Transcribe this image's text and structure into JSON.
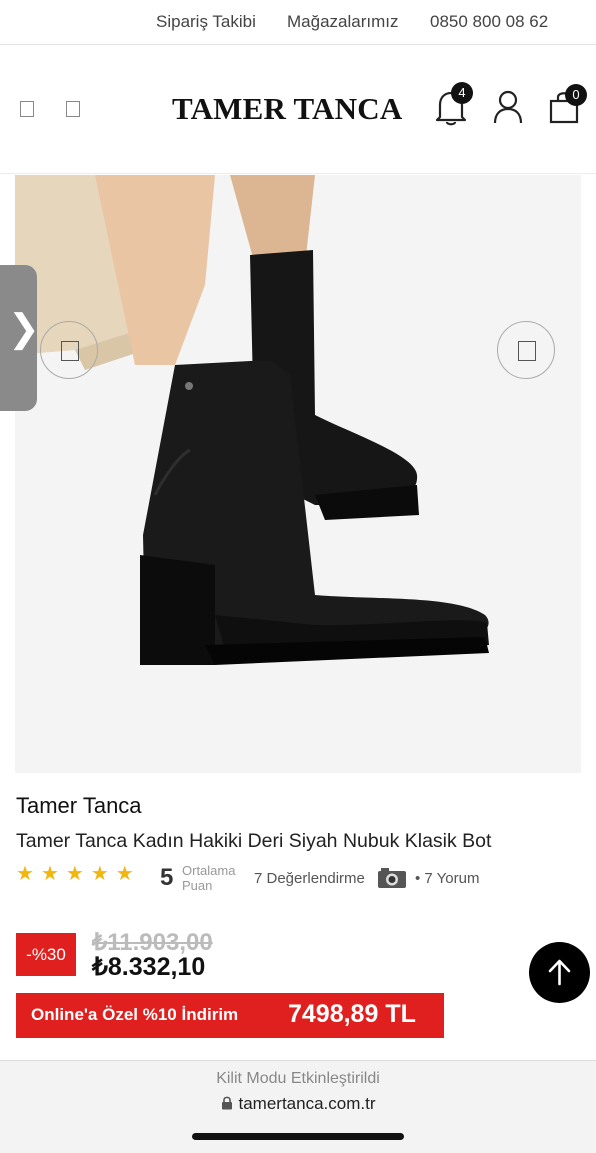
{
  "top_links": {
    "order_tracking": "Sipariş Takibi",
    "stores": "Mağazalarımız",
    "phone": "0850 800 08 62"
  },
  "header": {
    "logo": "TAMER TANCA",
    "notification_count": "4",
    "cart_count": "0"
  },
  "product": {
    "brand": "Tamer Tanca",
    "title": "Tamer Tanca Kadın Hakiki Deri Siyah Nubuk Klasik Bot",
    "rating": {
      "stars": 5,
      "score": "5",
      "score_label_1": "Ortalama",
      "score_label_2": "Puan",
      "reviews": "7 Değerlendirme",
      "comments": "• 7 Yorum"
    },
    "discount_badge": "-%30",
    "old_price": "₺11.903,00",
    "new_price": "₺8.332,10",
    "promo_label": "Online'a Özel %10 İndirim",
    "promo_price": "7498,89 TL"
  },
  "browser": {
    "lock_message": "Kilit Modu Etkinleştirildi",
    "url": "tamertanca.com.tr"
  }
}
